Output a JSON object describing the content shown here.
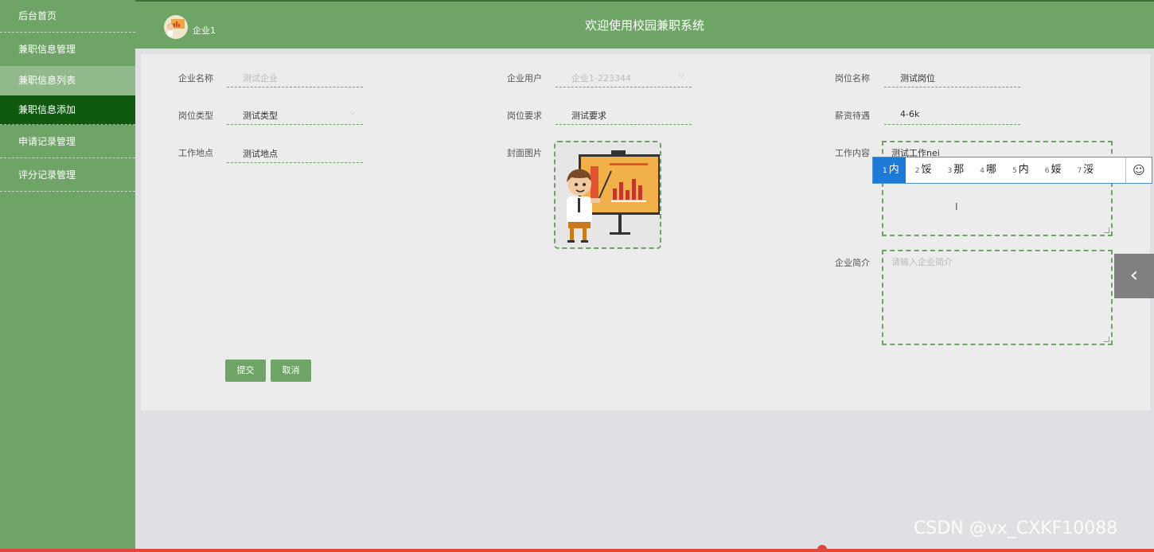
{
  "sidebar": {
    "items": [
      {
        "label": "后台首页"
      },
      {
        "label": "兼职信息管理"
      },
      {
        "label": "兼职信息列表"
      },
      {
        "label": "兼职信息添加"
      },
      {
        "label": "申请记录管理"
      },
      {
        "label": "评分记录管理"
      }
    ]
  },
  "header": {
    "user": "企业1",
    "title": "欢迎使用校园兼职系统"
  },
  "form": {
    "company_name": {
      "label": "企业名称",
      "value": "测试企业"
    },
    "company_user": {
      "label": "企业用户",
      "value": "企业1-223344"
    },
    "position_name": {
      "label": "岗位名称",
      "value": "测试岗位"
    },
    "position_type": {
      "label": "岗位类型",
      "value": "测试类型"
    },
    "position_req": {
      "label": "岗位要求",
      "value": "测试要求"
    },
    "salary": {
      "label": "薪资待遇",
      "value": "4-6k"
    },
    "work_place": {
      "label": "工作地点",
      "value": "测试地点"
    },
    "cover": {
      "label": "封面图片"
    },
    "work_content": {
      "label": "工作内容",
      "value": "测试工作nei"
    },
    "company_intro": {
      "label": "企业简介",
      "placeholder": "请输入企业简介"
    }
  },
  "buttons": {
    "submit": "提交",
    "cancel": "取消"
  },
  "ime": {
    "candidates": [
      {
        "num": "1",
        "char": "内"
      },
      {
        "num": "2",
        "char": "馁"
      },
      {
        "num": "3",
        "char": "那"
      },
      {
        "num": "4",
        "char": "哪"
      },
      {
        "num": "5",
        "char": "内"
      },
      {
        "num": "6",
        "char": "娞"
      },
      {
        "num": "7",
        "char": "浽"
      }
    ],
    "emoji": "☺"
  },
  "collapse_icon": "‹",
  "watermark": "CSDN @vx_CXKF10088",
  "colors": {
    "theme": "#6ea466",
    "active": "#0f5a0f",
    "ime_active": "#1d7ad6"
  }
}
